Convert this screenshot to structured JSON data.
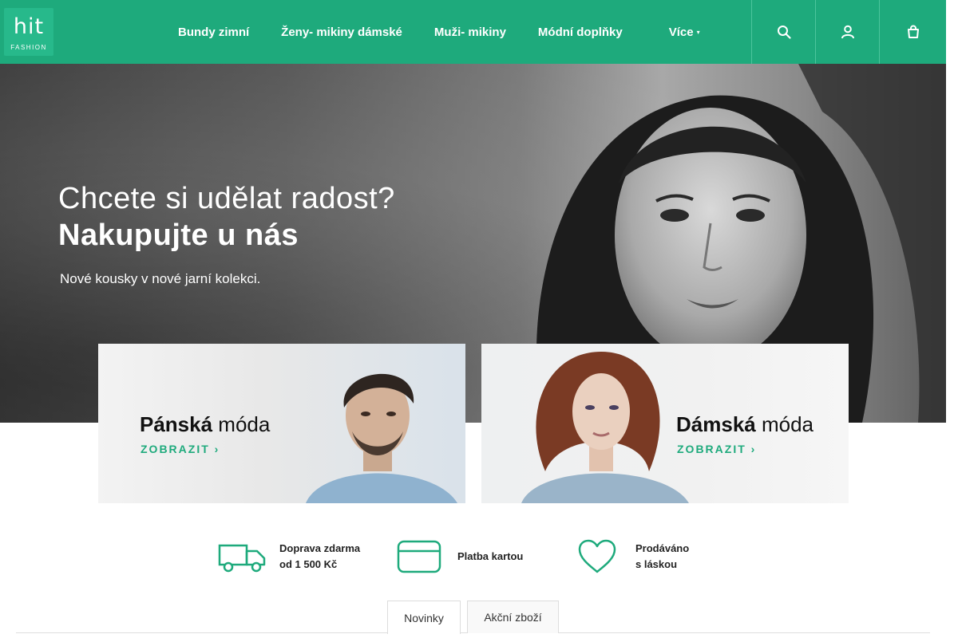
{
  "header": {
    "logo": {
      "word": "hit",
      "sub": "FASHION"
    },
    "nav": [
      "Bundy zimní",
      "Ženy- mikiny dámské",
      "Muži- mikiny",
      "Módní doplňky"
    ],
    "more_label": "Více",
    "buttons": [
      "search-icon",
      "user-icon",
      "cart-icon"
    ]
  },
  "hero": {
    "line1": "Chcete si udělat radost?",
    "line2": "Nakupujte u nás",
    "line3": "Nové kousky v nové jarní kolekci."
  },
  "categories": [
    {
      "strong": "Pánská",
      "rest": " móda",
      "cta": "ZOBRAZIT ›"
    },
    {
      "strong": "Dámská",
      "rest": " móda",
      "cta": "ZOBRAZIT ›"
    }
  ],
  "benefits": [
    {
      "icon": "truck-icon",
      "line1": "Doprava zdarma",
      "line2": "od 1 500 Kč"
    },
    {
      "icon": "credit-card-icon",
      "line1": "Platba kartou",
      "line2": ""
    },
    {
      "icon": "heart-icon",
      "line1": "Prodáváno",
      "line2": "s láskou"
    }
  ],
  "tabs": [
    "Novinky",
    "Akční zboží"
  ],
  "colors": {
    "brand": "#1eaa7c",
    "logo_bg": "#27b98b",
    "text_dark": "#111111"
  }
}
